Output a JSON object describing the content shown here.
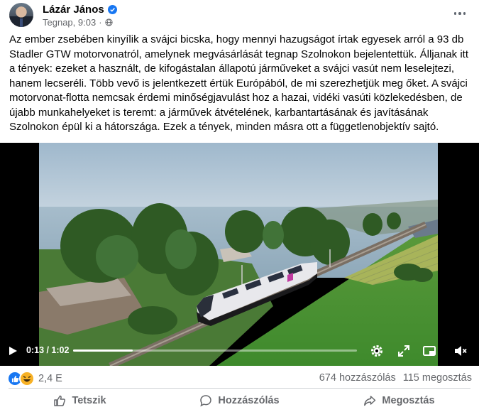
{
  "post": {
    "author": "Lázár János",
    "timestamp": "Tegnap, 9:03",
    "text": "Az ember zsebében kinyílik a svájci bicska, hogy mennyi hazugságot írtak egyesek arról a 93 db Stadler GTW motorvonatról, amelynek megvásárlását tegnap Szolnokon bejelentettük. Álljanak itt a tények: ezeket a használt, de kifogástalan állapotú járműveket a svájci vasút nem leselejtezi, hanem lecseréli. Több vevő is jelentkezett értük Európából, de mi szerezhetjük meg őket. A svájci motorvonat-flotta nemcsak érdemi minőségjavulást hoz a hazai, vidéki vasúti közlekedésben, de újabb munkahelyeket is teremt: a járművek átvételének, karbantartásának és javításának Szolnokon épül ki a hátországa. Ezek a tények, minden másra ott a függetlenobjektív sajtó."
  },
  "video": {
    "time": "0:13 / 1:02",
    "progress": 0.21
  },
  "reactions": {
    "count": "2,4 E",
    "comments": "674 hozzászólás",
    "shares": "115 megosztás"
  },
  "actions": {
    "like": "Tetszik",
    "comment": "Hozzászólás",
    "share": "Megosztás"
  },
  "icons": [
    "verified-icon",
    "globe-icon",
    "more-icon",
    "play-icon",
    "settings-icon",
    "fullscreen-icon",
    "miniplayer-icon",
    "mute-icon",
    "like-icon",
    "comment-icon",
    "share-icon"
  ],
  "colors": {
    "accent": "#1877f2",
    "text_secondary": "#65676b"
  }
}
